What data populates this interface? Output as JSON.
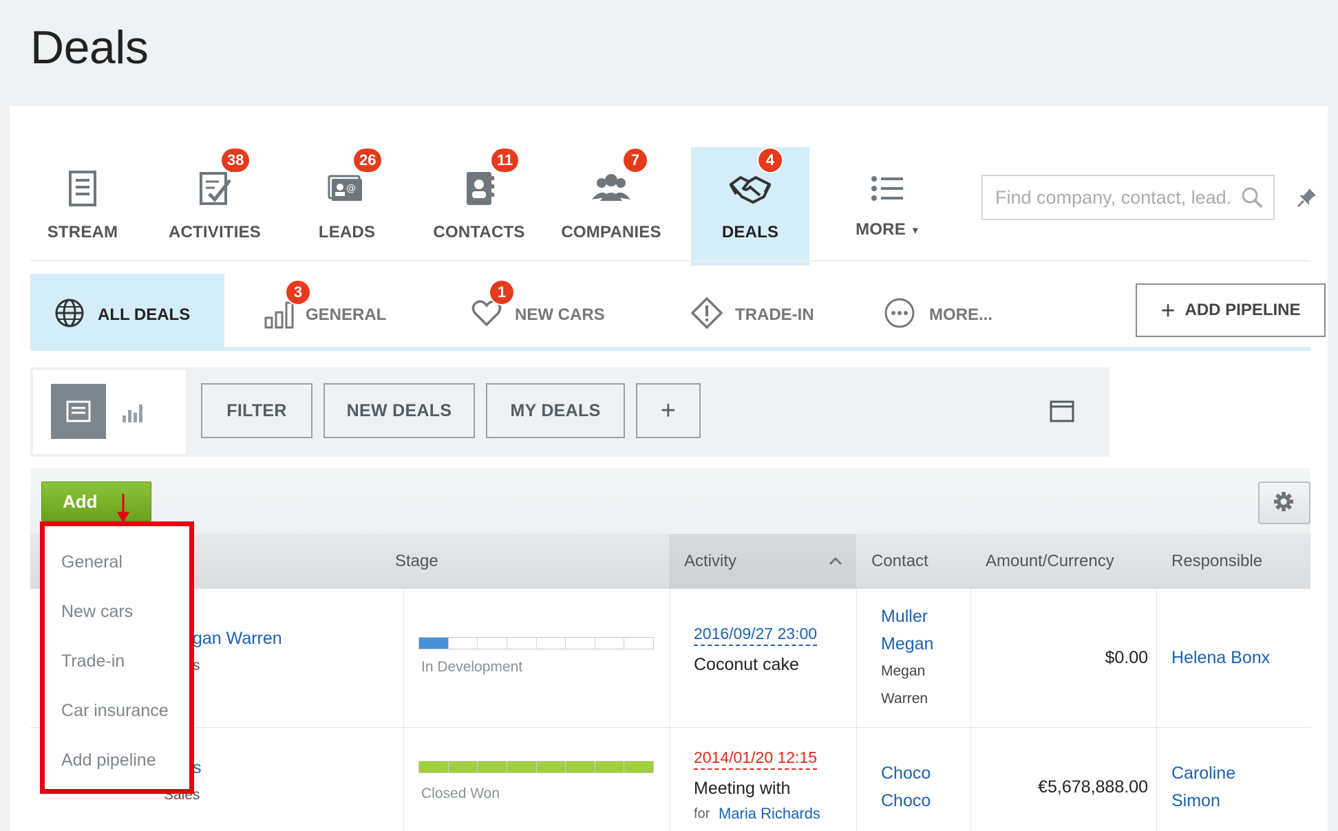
{
  "page": {
    "title": "Deals"
  },
  "nav": {
    "items": [
      {
        "label": "STREAM",
        "icon": "stream-icon",
        "badge": ""
      },
      {
        "label": "ACTIVITIES",
        "icon": "activities-icon",
        "badge": "38"
      },
      {
        "label": "LEADS",
        "icon": "leads-icon",
        "badge": "26"
      },
      {
        "label": "CONTACTS",
        "icon": "contacts-icon",
        "badge": "11"
      },
      {
        "label": "COMPANIES",
        "icon": "companies-icon",
        "badge": "7"
      },
      {
        "label": "DEALS",
        "icon": "handshake-icon",
        "badge": "4"
      },
      {
        "label": "MORE",
        "icon": "list-icon",
        "badge": ""
      }
    ],
    "search_placeholder": "Find company, contact, lead...",
    "active_color": "#d5edf8",
    "badge_color": "#e63a1c"
  },
  "pipelines": {
    "tabs": [
      {
        "label": "ALL DEALS",
        "icon": "globe-icon",
        "badge": ""
      },
      {
        "label": "GENERAL",
        "icon": "bar-chart-icon",
        "badge": "3"
      },
      {
        "label": "NEW CARS",
        "icon": "heart-icon",
        "badge": "1"
      },
      {
        "label": "TRADE-IN",
        "icon": "warning-diamond-icon",
        "badge": ""
      },
      {
        "label": "MORE...",
        "icon": "more-circle-icon",
        "badge": ""
      }
    ],
    "add_label": "ADD PIPELINE"
  },
  "filters": {
    "buttons": [
      "FILTER",
      "NEW DEALS",
      "MY DEALS"
    ],
    "add_symbol": "+"
  },
  "grid": {
    "add_button": "Add",
    "columns": {
      "stage": "Stage",
      "activity": "Activity",
      "contact": "Contact",
      "amount": "Amount/Currency",
      "responsible": "Responsible"
    },
    "rows": [
      {
        "deal_fragment": "gan Warren",
        "deal_sub_fragment": "s",
        "stage": "In Development",
        "stage_progress": 0.125,
        "stage_color": "#4a90d9",
        "activity_date": "2016/09/27 23:00",
        "activity_title": "Coconut cake",
        "contact_line1": "Muller",
        "contact_line2": "Megan",
        "company_line1": "Megan",
        "company_line2": "Warren",
        "amount": "$0.00",
        "responsible_line1": "Helena Bonx",
        "responsible_line2": ""
      },
      {
        "deal_fragment": "s",
        "deal_sub_fragment": "Sales",
        "stage": "Closed Won",
        "stage_progress": 1.0,
        "stage_color": "#a2cf3c",
        "activity_date": "2014/01/20 12:15",
        "activity_title": "Meeting with",
        "activity_for": "for",
        "activity_person": "Maria Richards",
        "contact_line1": "Choco",
        "contact_line2": "Choco",
        "amount": "€5,678,888.00",
        "responsible_line1": "Caroline",
        "responsible_line2": "Simon"
      }
    ]
  },
  "add_menu": {
    "items": [
      "General",
      "New cars",
      "Trade-in",
      "Car insurance",
      "Add pipeline"
    ],
    "highlight_color": "#e60012"
  }
}
